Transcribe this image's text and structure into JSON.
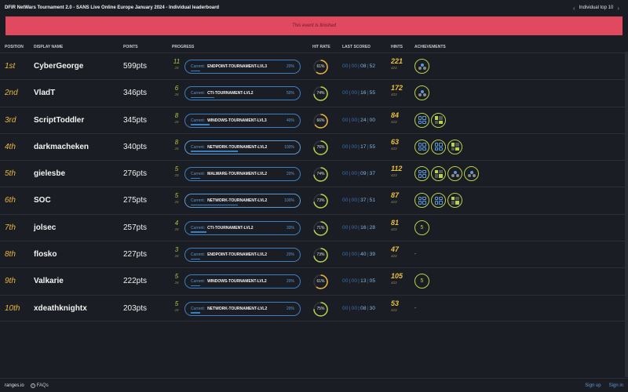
{
  "header": {
    "title": "DFIR NetWars Tournament 2.0 - SANS Live Online Europe January 2024 - Individual leaderboard",
    "nav_label": "Individual top 10",
    "prev_icon": "chevron-left-icon",
    "next_icon": "chevron-right-icon"
  },
  "banner": {
    "text": "This event is finished"
  },
  "columns": {
    "position": "POSITION",
    "display_name": "DISPLAY NAME",
    "points": "POINTS",
    "progress": "PROGRESS",
    "hit_rate": "HIT RATE",
    "last_scored": "LAST SCORED",
    "hints": "HINTS",
    "achievements": "ACHIEVEMENTS"
  },
  "colors": {
    "accent_blue": "#5b9bd5",
    "gold": "#e9b73d",
    "green": "#a7c83b",
    "banner_red": "#e0495e"
  },
  "rows": [
    {
      "position": "1st",
      "name": "CyberGeorge",
      "points": "599pts",
      "progress_count": "11",
      "progress_total": "28",
      "current_label": "Current:",
      "current_level": "ENDPOINT-TOURNAMENT-LVL3",
      "level_pct": "20%",
      "level_fill": 0.2,
      "hit_rate": "61%",
      "hit_value": 0.61,
      "last": [
        "00",
        "00",
        "08",
        "52"
      ],
      "hints": "221",
      "hints_total": "423",
      "achievements": [
        "dots"
      ]
    },
    {
      "position": "2nd",
      "name": "VladT",
      "points": "346pts",
      "progress_count": "6",
      "progress_total": "28",
      "current_label": "Current:",
      "current_level": "CTI-TOURNAMENT-LVL2",
      "level_pct": "50%",
      "level_fill": 0.5,
      "hit_rate": "74%",
      "hit_value": 0.74,
      "last": [
        "00",
        "00",
        "16",
        "55"
      ],
      "hints": "172",
      "hints_total": "423",
      "achievements": [
        "dots"
      ]
    },
    {
      "position": "3rd",
      "name": "ScriptToddler",
      "points": "345pts",
      "progress_count": "8",
      "progress_total": "28",
      "current_label": "Current:",
      "current_level": "WINDOWS-TOURNAMENT-LVL3",
      "level_pct": "40%",
      "level_fill": 0.4,
      "hit_rate": "66%",
      "hit_value": 0.66,
      "last": [
        "00",
        "00",
        "24",
        "00"
      ],
      "hints": "84",
      "hints_total": "423",
      "achievements": [
        "grid-blue",
        "grid-mixed"
      ]
    },
    {
      "position": "4th",
      "name": "darkmacheken",
      "points": "340pts",
      "progress_count": "8",
      "progress_total": "28",
      "current_label": "Current:",
      "current_level": "NETWORK-TOURNAMENT-LVL2",
      "level_pct": "100%",
      "level_fill": 1.0,
      "hit_rate": "76%",
      "hit_value": 0.76,
      "last": [
        "00",
        "00",
        "17",
        "55"
      ],
      "hints": "63",
      "hints_total": "423",
      "achievements": [
        "grid-blue",
        "grid-blue",
        "grid-mixed"
      ]
    },
    {
      "position": "5th",
      "name": "gielesbe",
      "points": "276pts",
      "progress_count": "5",
      "progress_total": "28",
      "current_label": "Current:",
      "current_level": "MALWARE-TOURNAMENT-LVL2",
      "level_pct": "20%",
      "level_fill": 0.2,
      "hit_rate": "74%",
      "hit_value": 0.74,
      "last": [
        "00",
        "00",
        "09",
        "37"
      ],
      "hints": "112",
      "hints_total": "423",
      "achievements": [
        "grid-blue",
        "grid-mixed",
        "dots",
        "dots"
      ]
    },
    {
      "position": "6th",
      "name": "SOC",
      "points": "275pts",
      "progress_count": "5",
      "progress_total": "28",
      "current_label": "Current:",
      "current_level": "NETWORK-TOURNAMENT-LVL2",
      "level_pct": "100%",
      "level_fill": 1.0,
      "hit_rate": "73%",
      "hit_value": 0.73,
      "last": [
        "00",
        "00",
        "37",
        "51"
      ],
      "hints": "87",
      "hints_total": "423",
      "achievements": [
        "grid-blue",
        "grid-blue",
        "grid-mixed"
      ]
    },
    {
      "position": "7th",
      "name": "jolsec",
      "points": "257pts",
      "progress_count": "4",
      "progress_total": "28",
      "current_label": "Current:",
      "current_level": "CTI-TOURNAMENT-LVL2",
      "level_pct": "33%",
      "level_fill": 0.33,
      "hit_rate": "71%",
      "hit_value": 0.71,
      "last": [
        "00",
        "00",
        "16",
        "28"
      ],
      "hints": "81",
      "hints_total": "423",
      "achievements": [
        "num:5"
      ]
    },
    {
      "position": "8th",
      "name": "flosko",
      "points": "227pts",
      "progress_count": "3",
      "progress_total": "28",
      "current_label": "Current:",
      "current_level": "ENDPOINT-TOURNAMENT-LVL2",
      "level_pct": "20%",
      "level_fill": 0.2,
      "hit_rate": "73%",
      "hit_value": 0.73,
      "last": [
        "00",
        "00",
        "40",
        "39"
      ],
      "hints": "47",
      "hints_total": "423",
      "achievements": [
        "dash"
      ]
    },
    {
      "position": "9th",
      "name": "Valkarie",
      "points": "222pts",
      "progress_count": "5",
      "progress_total": "28",
      "current_label": "Current:",
      "current_level": "WINDOWS-TOURNAMENT-LVL2",
      "level_pct": "20%",
      "level_fill": 0.2,
      "hit_rate": "61%",
      "hit_value": 0.61,
      "last": [
        "00",
        "00",
        "13",
        "05"
      ],
      "hints": "105",
      "hints_total": "423",
      "achievements": [
        "num:5"
      ]
    },
    {
      "position": "10th",
      "name": "xdeathknightx",
      "points": "203pts",
      "progress_count": "5",
      "progress_total": "28",
      "current_label": "Current:",
      "current_level": "NETWORK-TOURNAMENT-LVL2",
      "level_pct": "20%",
      "level_fill": 0.2,
      "hit_rate": "75%",
      "hit_value": 0.75,
      "last": [
        "00",
        "00",
        "08",
        "30"
      ],
      "hints": "53",
      "hints_total": "423",
      "achievements": [
        "dash"
      ]
    }
  ],
  "footer": {
    "brand": "ranges.io",
    "faq": "FAQs",
    "faq_icon": "question-circle-icon",
    "sign_up": "Sign up",
    "sign_in": "Sign in"
  }
}
